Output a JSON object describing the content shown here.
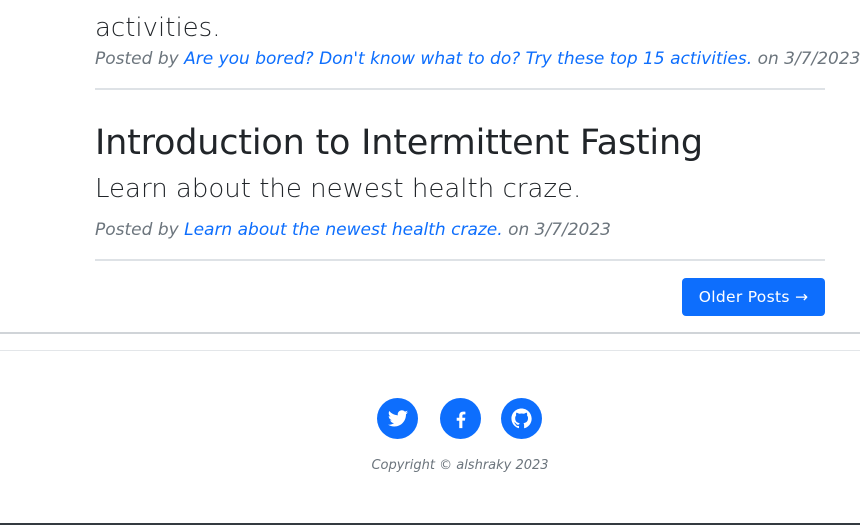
{
  "previous_post": {
    "subtitle_line2": "activities.",
    "meta_prefix": "Posted by",
    "author_link": "Are you bored? Don't know what to do? Try these top 15 activities.",
    "meta_suffix": "on 3/7/2023"
  },
  "post": {
    "title": "Introduction to Intermittent Fasting",
    "subtitle": "Learn about the newest health craze.",
    "meta_prefix": "Posted by",
    "author_link": "Learn about the newest health craze.",
    "meta_suffix": "on 3/7/2023"
  },
  "pager": {
    "older_label": "Older Posts →"
  },
  "footer": {
    "social": [
      {
        "name": "twitter-icon"
      },
      {
        "name": "facebook-icon"
      },
      {
        "name": "github-icon"
      }
    ],
    "copyright": "Copyright © alshraky 2023"
  },
  "colors": {
    "accent": "#0d6efd",
    "muted": "#6c757d",
    "text": "#212529",
    "divider": "#dee2e6"
  }
}
